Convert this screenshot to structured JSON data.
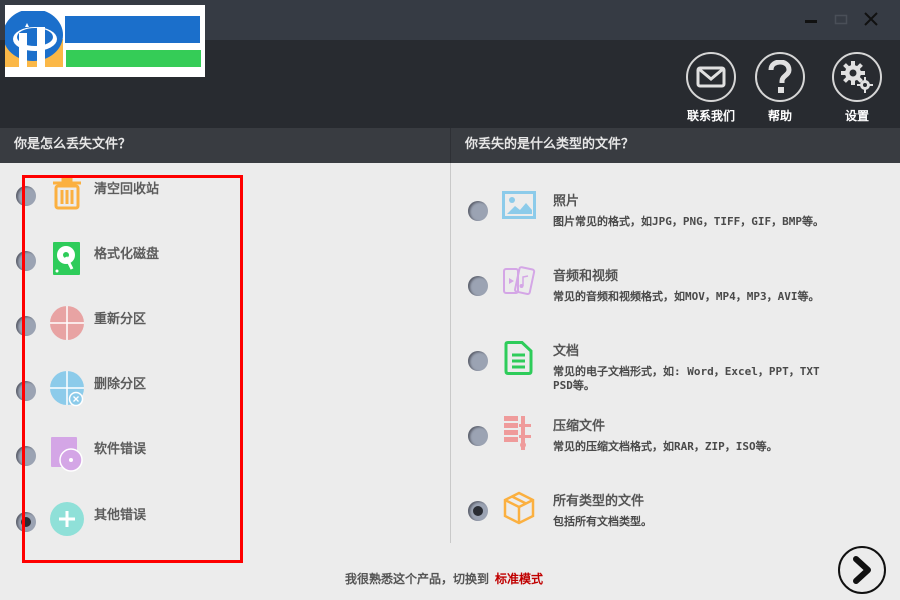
{
  "window": {
    "controls": {
      "minimize": "minimize",
      "maximize": "maximize",
      "close": "close"
    }
  },
  "header": {
    "actions": [
      {
        "label": "联系我们",
        "icon": "mail-icon"
      },
      {
        "label": "帮助",
        "icon": "help-icon"
      },
      {
        "label": "设置",
        "icon": "gear-icon"
      }
    ]
  },
  "left_panel": {
    "heading": "你是怎么丢失文件？",
    "options": [
      {
        "label": "清空回收站",
        "icon": "trash-icon",
        "color": "#fbb040",
        "selected": false
      },
      {
        "label": "格式化磁盘",
        "icon": "hard-disk-icon",
        "color": "#2ecc5a",
        "selected": false
      },
      {
        "label": "重新分区",
        "icon": "partition-icon",
        "color": "#e8a3a3",
        "selected": false
      },
      {
        "label": "删除分区",
        "icon": "delete-partition-icon",
        "color": "#8ccbea",
        "selected": false
      },
      {
        "label": "软件错误",
        "icon": "software-error-icon",
        "color": "#d4a6e6",
        "selected": false
      },
      {
        "label": "其他错误",
        "icon": "plus-icon",
        "color": "#8fe0d8",
        "selected": true
      }
    ]
  },
  "right_panel": {
    "heading": "你丢失的是什么类型的文件？",
    "options": [
      {
        "title": "照片",
        "desc": "图片常见的格式，如JPG，PNG，TIFF，GIF，BMP等。",
        "icon": "image-icon",
        "color": "#8ccbea",
        "selected": false
      },
      {
        "title": "音频和视频",
        "desc": "常见的音频和视频格式，如MOV，MP4，MP3，AVI等。",
        "icon": "media-icon",
        "color": "#d4a6e6",
        "selected": false
      },
      {
        "title": "文档",
        "desc": "常见的电子文档形式，如: Word，Excel，PPT，TXT PSD等。",
        "icon": "document-icon",
        "color": "#2ecc5a",
        "selected": false
      },
      {
        "title": "压缩文件",
        "desc": "常见的压缩文档格式，如RAR，ZIP，ISO等。",
        "icon": "archive-icon",
        "color": "#ef9b9b",
        "selected": false
      },
      {
        "title": "所有类型的文件",
        "desc": "包括所有文档类型。",
        "icon": "box-icon",
        "color": "#fbb040",
        "selected": true
      }
    ]
  },
  "footer": {
    "prompt": "我很熟悉这个产品，切换到",
    "link": "标准模式",
    "next": "next"
  },
  "colors": {
    "link": "#c00000",
    "highlight": "#ff0000"
  }
}
